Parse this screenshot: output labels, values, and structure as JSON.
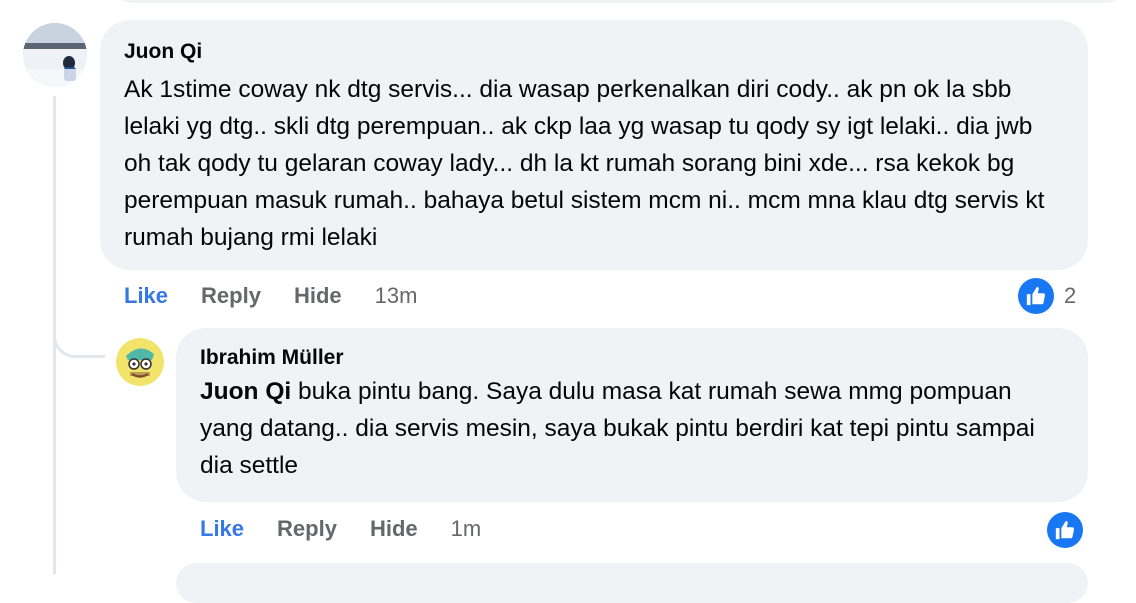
{
  "comment": {
    "author": "Juon Qi",
    "text": "Ak 1stime coway nk dtg servis... dia wasap perkenalkan diri cody.. ak pn ok la sbb lelaki yg dtg.. skli dtg perempuan.. ak ckp laa yg wasap tu qody sy igt lelaki.. dia jwb oh tak qody tu gelaran coway lady... dh la kt rumah sorang bini xde... rsa kekok bg perempuan masuk rumah.. bahaya betul sistem mcm ni.. mcm mna klau dtg servis kt rumah bujang rmi lelaki",
    "actions": {
      "like": "Like",
      "reply": "Reply",
      "hide": "Hide"
    },
    "time": "13m",
    "reaction_count": "2",
    "reaction_icon": "thumbs-up-icon"
  },
  "reply": {
    "author": "Ibrahim Müller",
    "mention": "Juon Qi",
    "text": " buka pintu bang. Saya dulu masa kat rumah sewa mmg pompuan yang datang.. dia servis mesin, saya bukak pintu berdiri kat tepi pintu sampai dia settle",
    "actions": {
      "like": "Like",
      "reply": "Reply",
      "hide": "Hide"
    },
    "time": "1m",
    "reaction_icon": "thumbs-up-icon"
  },
  "colors": {
    "bubble": "#f0f2f5",
    "like_blue": "#1877f2",
    "secondary_text": "#65676b"
  }
}
